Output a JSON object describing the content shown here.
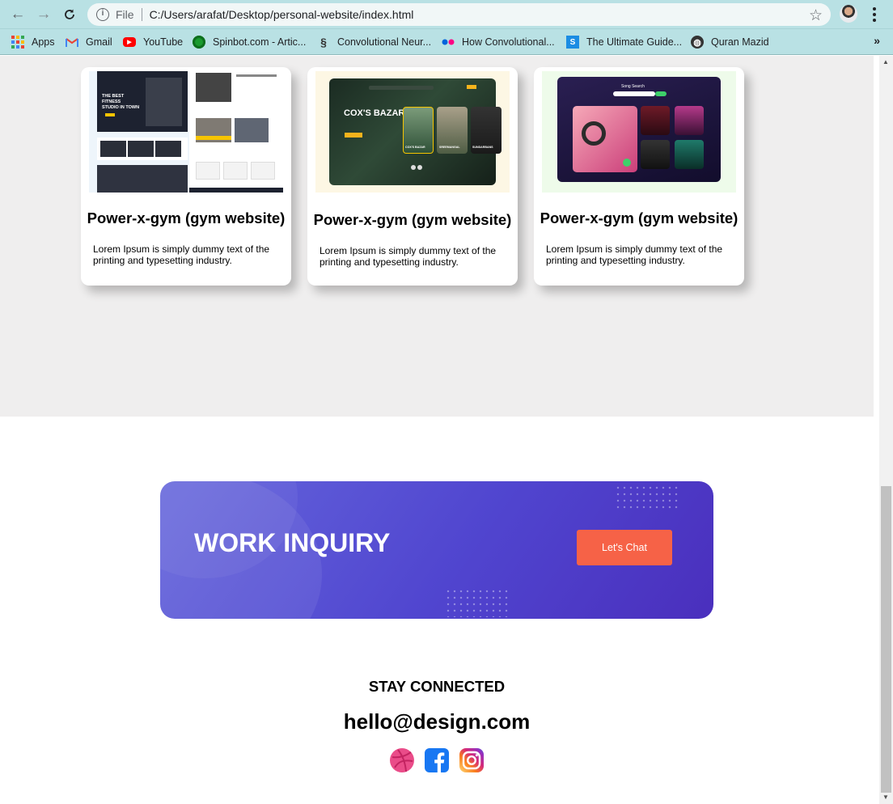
{
  "browser": {
    "file_label": "File",
    "url": "C:/Users/arafat/Desktop/personal-website/index.html",
    "bookmarks": [
      {
        "label": "Apps",
        "icon": "apps-grid-icon"
      },
      {
        "label": "Gmail",
        "icon": "gmail-icon"
      },
      {
        "label": "YouTube",
        "icon": "youtube-icon"
      },
      {
        "label": "Spinbot.com - Artic...",
        "icon": "spinbot-icon"
      },
      {
        "label": "Convolutional Neur...",
        "icon": "cnn-icon"
      },
      {
        "label": "How Convolutional...",
        "icon": "flickr-icon"
      },
      {
        "label": "The Ultimate Guide...",
        "icon": "s-logo-icon"
      },
      {
        "label": "Quran Mazid",
        "icon": "globe-icon"
      }
    ],
    "more_label": "»"
  },
  "projects": [
    {
      "title": "Power-x-gym (gym website)",
      "description": "Lorem Ipsum is simply dummy text of the printing and typesetting industry.",
      "thumb_text": [
        "THE BEST FITNESS",
        "STUDIO IN TOWN"
      ]
    },
    {
      "title": "Power-x-gym (gym website)",
      "description": "Lorem Ipsum is simply dummy text of the printing and typesetting industry.",
      "thumb_text": [
        "COX'S BAZAR",
        "COX'S BAZAR",
        "SREEMANGAL",
        "SUNDARBANS"
      ]
    },
    {
      "title": "Power-x-gym (gym website)",
      "description": "Lorem Ipsum is simply dummy text of the printing and typesetting industry.",
      "thumb_text": [
        "Song Search"
      ]
    }
  ],
  "inquiry": {
    "title": "WORK INQUIRY",
    "button_label": "Let's Chat"
  },
  "footer": {
    "heading": "STAY CONNECTED",
    "email": "hello@design.com",
    "social": [
      "dribbble-icon",
      "facebook-icon",
      "instagram-icon"
    ]
  },
  "colors": {
    "browser_frame": "#b9e1e4",
    "section_bg": "#efeeee",
    "inquiry_gradient_start": "#6566dc",
    "inquiry_gradient_end": "#4a2fbd",
    "chat_button": "#f66247",
    "dribbble": "#ea4c89",
    "facebook": "#1877f2"
  }
}
